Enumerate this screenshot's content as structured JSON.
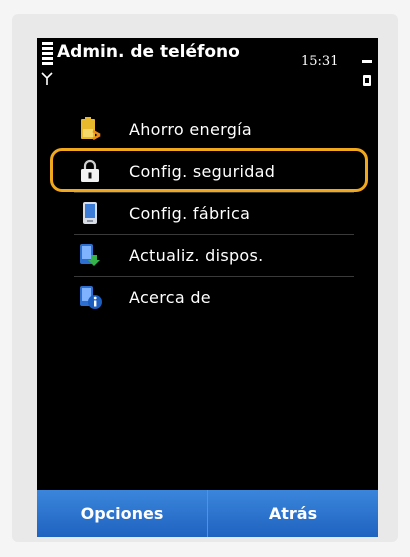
{
  "status": {
    "title": "Admin. de teléfono",
    "time": "15:31"
  },
  "menu": {
    "items": [
      {
        "label": "Ahorro energía",
        "icon": "power-saving-icon"
      },
      {
        "label": "Config. seguridad",
        "icon": "lock-icon"
      },
      {
        "label": "Config. fábrica",
        "icon": "phone-icon"
      },
      {
        "label": "Actualiz. dispos.",
        "icon": "device-update-icon"
      },
      {
        "label": "Acerca de",
        "icon": "info-icon"
      }
    ],
    "highlighted_index": 1
  },
  "softkeys": {
    "left": "Opciones",
    "right": "Atrás"
  },
  "colors": {
    "highlight": "#f1a81c",
    "softkey_bar": "#2a73cf",
    "screen_bg": "#000000"
  }
}
